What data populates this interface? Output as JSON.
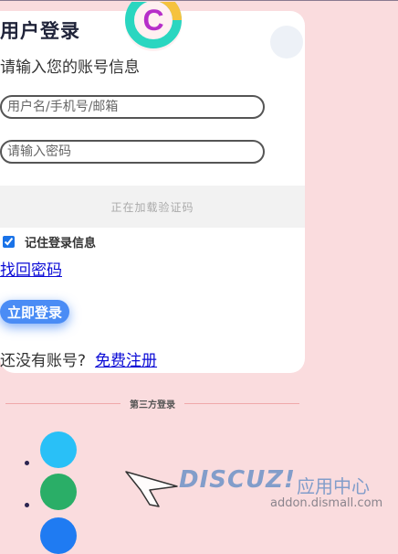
{
  "header": {
    "title": "用户登录",
    "subtitle": "请输入您的账号信息"
  },
  "form": {
    "username_placeholder": "用户名/手机号/邮箱",
    "password_placeholder": "请输入密码",
    "captcha_status": "正在加载验证码",
    "remember_label": "记住登录信息",
    "remember_checked": true,
    "forgot_label": "找回密码",
    "login_label": "立即登录",
    "no_account_text": "还没有账号?",
    "register_label": "免费注册"
  },
  "third_party": {
    "label": "第三方登录",
    "items": [
      {
        "icon": "social-login-icon-1",
        "color": "#29c0f7"
      },
      {
        "icon": "social-login-icon-2",
        "color": "#2aae67"
      },
      {
        "icon": "social-login-icon-3",
        "color": "#1f7bf2"
      }
    ]
  },
  "watermark": {
    "brand": "DISCUZ!",
    "suffix": "应用中心",
    "url": "addon.dismall.com"
  },
  "colors": {
    "accent": "#4a8cf5",
    "background": "#fadcde",
    "link": "#0b0bd6"
  }
}
